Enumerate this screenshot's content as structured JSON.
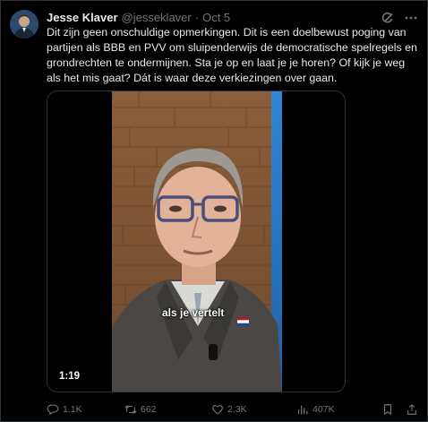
{
  "tweet": {
    "author_name": "Jesse Klaver",
    "handle": "@jesseklaver",
    "separator": "·",
    "date": "Oct 5",
    "text": "Dit zijn geen onschuldige opmerkingen. Dit is een doelbewust poging van partijen als BBB en PVV om sluipenderwijs de democratische spelregels en grondrechten te ondermijnen. Sta je op en laat je je horen? Of kijk je weg als het mis gaat? Dát is waar deze verkiezingen over gaan.",
    "video": {
      "caption": "als je vertelt",
      "duration": "1:19"
    },
    "actions": {
      "replies": "1.1K",
      "reposts": "662",
      "likes": "2.3K",
      "views": "407K"
    }
  },
  "colors": {
    "text": "#e7e9ea",
    "muted": "#71767b",
    "border": "#2f3336",
    "background": "#000000"
  },
  "icons": [
    "avatar-photo",
    "grok-icon",
    "more-icon",
    "reply-icon",
    "repost-icon",
    "like-icon",
    "views-icon",
    "bookmark-icon",
    "share-icon"
  ]
}
